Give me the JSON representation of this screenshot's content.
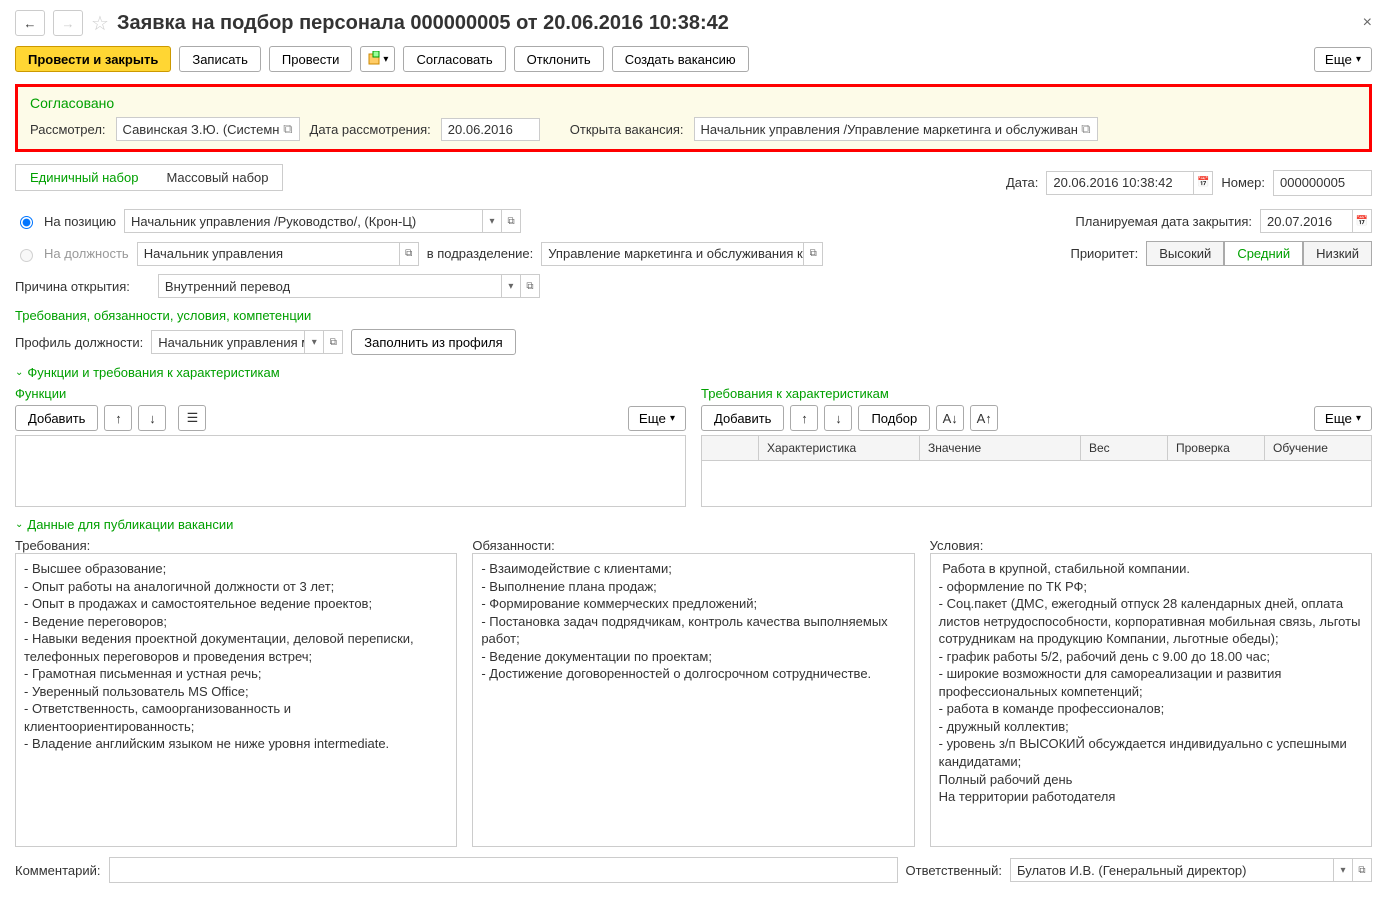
{
  "header": {
    "title": "Заявка на подбор персонала 000000005 от 20.06.2016 10:38:42"
  },
  "toolbar": {
    "post_close": "Провести и закрыть",
    "save": "Записать",
    "post": "Провести",
    "approve": "Согласовать",
    "reject": "Отклонить",
    "create_vacancy": "Создать вакансию",
    "more": "Еще"
  },
  "approval": {
    "status": "Согласовано",
    "reviewed_by_lbl": "Рассмотрел:",
    "reviewed_by": "Савинская З.Ю. (Системн",
    "review_date_lbl": "Дата рассмотрения:",
    "review_date": "20.06.2016",
    "vacancy_open_lbl": "Открыта вакансия:",
    "vacancy_open": "Начальник управления /Управление маркетинга и обслуживани"
  },
  "tabs": {
    "single": "Единичный набор",
    "mass": "Массовый набор"
  },
  "doc": {
    "date_lbl": "Дата:",
    "date": "20.06.2016 10:38:42",
    "number_lbl": "Номер:",
    "number": "000000005",
    "to_position_lbl": "На позицию",
    "to_position": "Начальник управления /Руководство/, (Крон-Ц)",
    "plan_date_lbl": "Планируемая дата закрытия:",
    "plan_date": "20.07.2016",
    "to_job_lbl": "На должность",
    "to_job": "Начальник управления",
    "to_dept_lbl": "в подразделение:",
    "to_dept": "Управление маркетинга и обслуживания клиентов",
    "priority_lbl": "Приоритет:",
    "priority": {
      "high": "Высокий",
      "med": "Средний",
      "low": "Низкий"
    },
    "reason_lbl": "Причина открытия:",
    "reason": "Внутренний перевод"
  },
  "req_section": {
    "title": "Требования, обязанности, условия, компетенции",
    "profile_lbl": "Профиль должности:",
    "profile": "Начальник управления ма",
    "fill_btn": "Заполнить из профиля"
  },
  "funcs": {
    "header": "Функции и требования к характеристикам",
    "functions_lbl": "Функции",
    "chars_lbl": "Требования к характеристикам",
    "add": "Добавить",
    "select": "Подбор",
    "more": "Еще",
    "cols": {
      "char": "Характеристика",
      "val": "Значение",
      "weight": "Вес",
      "check": "Проверка",
      "train": "Обучение"
    }
  },
  "pub": {
    "header": "Данные для публикации вакансии",
    "req_lbl": "Требования:",
    "duty_lbl": "Обязанности:",
    "cond_lbl": "Условия:",
    "requirements": "- Высшее образование;\n- Опыт работы на аналогичной должности от 3 лет;\n- Опыт в продажах и самостоятельное ведение проектов;\n- Ведение переговоров;\n- Навыки ведения проектной документации, деловой переписки, телефонных переговоров и проведения встреч;\n- Грамотная письменная и устная речь;\n- Уверенный пользователь MS Office;\n- Ответственность, самоорганизованность и клиентоориентированность;\n- Владение английским языком не ниже уровня intermediate.",
    "duties": "- Взаимодействие с клиентами;\n- Выполнение плана продаж;\n- Формирование коммерческих предложений;\n- Постановка задач подрядчикам, контроль качества выполняемых работ;\n- Ведение документации по проектам;\n- Достижение договоренностей о долгосрочном сотрудничестве.",
    "conditions": " Работа в крупной, стабильной компании.\n- оформление по ТК РФ;\n- Соц.пакет (ДМС, ежегодный отпуск 28 календарных дней, оплата листов нетрудоспособности, корпоративная мобильная связь, льготы сотрудникам на продукцию Компании, льготные обеды);\n- график работы 5/2, рабочий день с 9.00 до 18.00 час;\n- широкие возможности для самореализации и развития профессиональных компетенций;\n- работа в команде профессионалов;\n- дружный коллектив;\n- уровень з/п ВЫСОКИЙ обсуждается индивидуально с успешными кандидатами;\nПолный рабочий день\nНа территории работодателя"
  },
  "footer": {
    "comment_lbl": "Комментарий:",
    "responsible_lbl": "Ответственный:",
    "responsible": "Булатов И.В. (Генеральный директор)"
  }
}
